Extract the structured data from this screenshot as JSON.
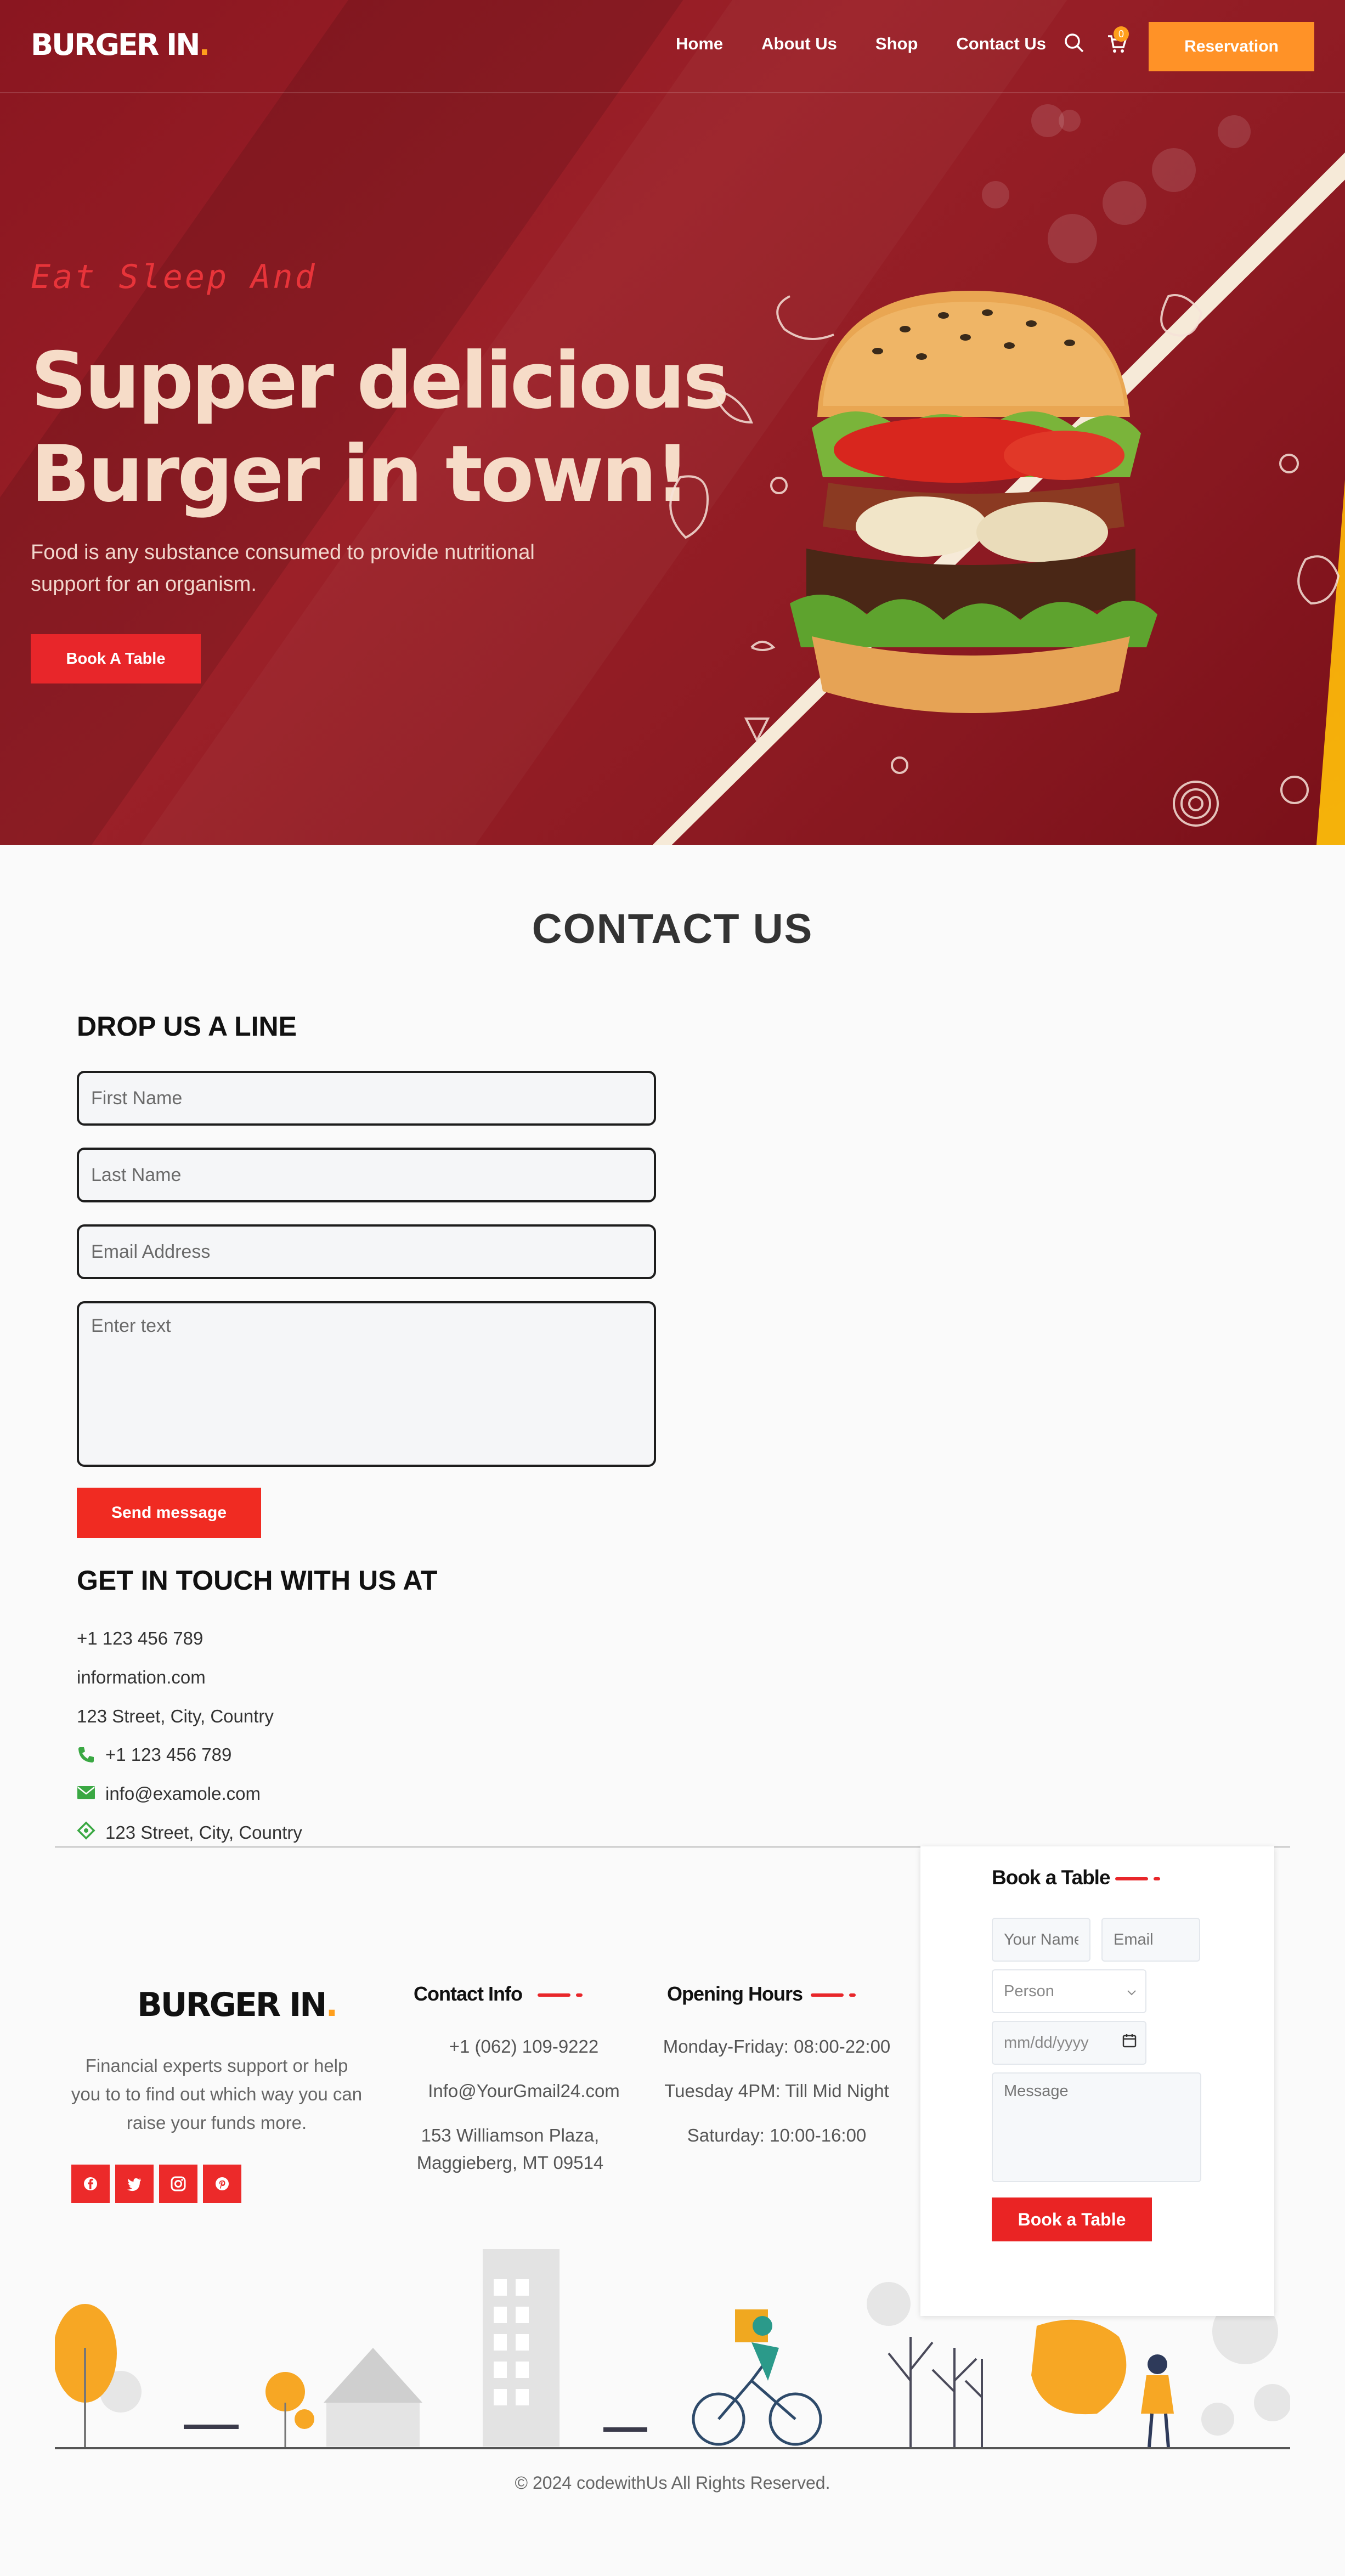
{
  "brand": {
    "name": "BURGER IN",
    "dot": ".",
    "accent": "#ff9f1c"
  },
  "nav": {
    "links": [
      "Home",
      "About Us",
      "Shop",
      "Contact Us"
    ],
    "cart_count": "0",
    "reservation_label": "Reservation",
    "icons": [
      "search-icon",
      "cart-icon"
    ]
  },
  "hero": {
    "tagline": "Eat Sleep And",
    "headline_line1": "Supper delicious",
    "headline_line2": "Burger in town!",
    "subtitle": "Food is any substance consumed to provide nutritional support for an organism.",
    "cta_label": "Book A Table",
    "colors": {
      "background": "#8f1a22",
      "accent": "#f5a20a",
      "cta": "#e8262a"
    }
  },
  "contact": {
    "title": "CONTACT US",
    "form_title": "DROP US A LINE",
    "placeholders": {
      "first_name": "First Name",
      "last_name": "Last Name",
      "email": "Email Address",
      "message": "Enter text"
    },
    "send_label": "Send message",
    "touch_title": "GET IN TOUCH WITH US AT",
    "lines": [
      "+1 123 456 789",
      "information.com",
      "123 Street, City, Country"
    ],
    "icon_lines": [
      {
        "icon": "phone-icon",
        "text": "+1 123 456 789"
      },
      {
        "icon": "envelope-icon",
        "text": "info@examole.com"
      },
      {
        "icon": "location-icon",
        "text": "123 Street, City, Country"
      }
    ],
    "icon_color": "#3aa843"
  },
  "footer": {
    "brand": "BURGER IN",
    "brand_dot": ".",
    "description": "Financial experts support or help you to to find out which way you can raise your funds more.",
    "social": [
      "facebook-icon",
      "twitter-icon",
      "instagram-icon",
      "pinterest-icon"
    ],
    "contact_info": {
      "title": "Contact Info",
      "phone": "+1 (062) 109-9222",
      "email": "Info@YourGmail24.com",
      "address": "153 Williamson Plaza, Maggieberg, MT 09514"
    },
    "opening_hours": {
      "title": "Opening Hours",
      "line1": "Monday-Friday: 08:00-22:00",
      "line2": "Tuesday 4PM: Till Mid Night",
      "line3": "Saturday: 10:00-16:00"
    },
    "book_table": {
      "title": "Book a Table",
      "name_placeholder": "Your Name",
      "email_placeholder": "Email",
      "person_option": "Person",
      "date_placeholder": "mm/dd/yyyy",
      "message_placeholder": "Message",
      "button_label": "Book a Table"
    },
    "copyright": "© 2024 codewithUs All Rights Reserved."
  }
}
